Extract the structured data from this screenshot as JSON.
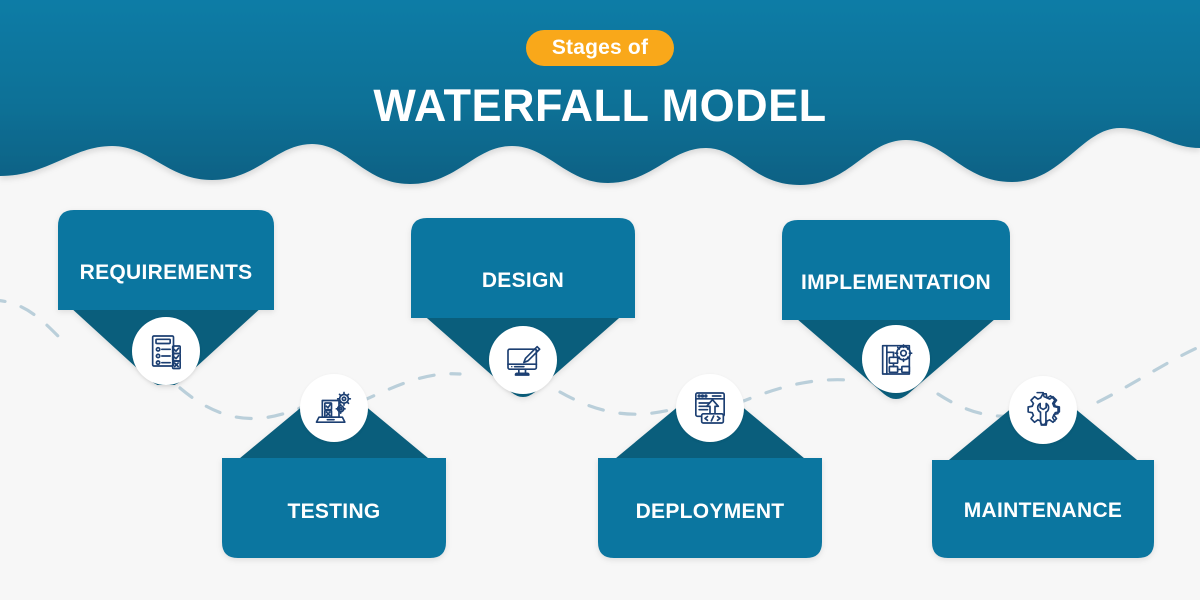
{
  "header": {
    "eyebrow": "Stages of",
    "title": "WATERFALL MODEL",
    "pill_color": "#F9A81A",
    "wave_color": "#0C7197",
    "text_color": "#FFFFFF"
  },
  "theme": {
    "background": "#F7F7F7",
    "card_color": "#0B76A0",
    "card_dark_color": "#0A5E7C",
    "icon_stroke": "#1C3F72",
    "connector_color": "#BACFDA"
  },
  "stages": [
    {
      "id": "requirements",
      "label": "REQUIREMENTS",
      "icon": "checklist-clipboard-icon",
      "direction": "down",
      "order": 1
    },
    {
      "id": "testing",
      "label": "TESTING",
      "icon": "laptop-test-gear-icon",
      "direction": "up",
      "order": 2
    },
    {
      "id": "design",
      "label": "DESIGN",
      "icon": "monitor-paintbrush-icon",
      "direction": "down",
      "order": 3
    },
    {
      "id": "deployment",
      "label": "DEPLOYMENT",
      "icon": "browser-upload-code-icon",
      "direction": "up",
      "order": 4
    },
    {
      "id": "implementation",
      "label": "IMPLEMENTATION",
      "icon": "blueprint-gear-icon",
      "direction": "down",
      "order": 5
    },
    {
      "id": "maintenance",
      "label": "MAINTENANCE",
      "icon": "gear-wrench-icon",
      "direction": "up",
      "order": 6
    }
  ]
}
